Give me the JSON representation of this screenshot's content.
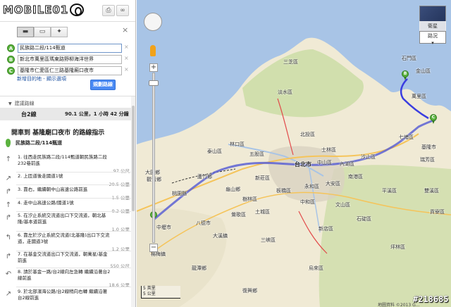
{
  "header": {
    "logo_text": "MOBILE01"
  },
  "toolbar": {
    "print_icon": "printer-icon",
    "link_icon": "link-icon"
  },
  "modes": [
    {
      "name": "drive",
      "glyph": "🚗",
      "active": true
    },
    {
      "name": "transit",
      "glyph": "🚌",
      "active": false
    },
    {
      "name": "walk",
      "glyph": "🚶",
      "active": false
    }
  ],
  "waypoints": [
    {
      "letter": "A",
      "value": "民族路二段/114甄道"
    },
    {
      "letter": "B",
      "value": "新北市萬里區瑪東路野柳海洋世界"
    },
    {
      "letter": "C",
      "value": "基隆市仁愛區仁三路基隆廟口夜市"
    }
  ],
  "route_links": "新增目的地 - 顯示選項",
  "route_button": "規劃路線",
  "suggested": {
    "heading": "建議路線",
    "route_name": "台2線",
    "distance_time": "90.1 公里，1 小時 42 分鐘"
  },
  "directions_title": "開車到 基隆廟口夜市 的路線指示",
  "start_label": "民族路二段/114甄道",
  "steps": [
    {
      "text": "1. 往西走民族路二段/114甄道朝民族路二段232巷前進",
      "dist": "97 公尺"
    },
    {
      "text": "2. 上匝道後走國道1號",
      "dist": "29.5 公里"
    },
    {
      "text": "3. 靠右，繼續朝中山高速公路前進",
      "dist": "1.5 公里"
    },
    {
      "text": "4. 走中山高速公路/國道1號",
      "dist": "9.2 公里"
    },
    {
      "text": "5. 在汐止系統交流道出口下交流道，朝北基隆/基本道前進",
      "dist": "1.0 公里"
    },
    {
      "text": "6. 靠左於汐止系統交流道(北基隆)出口下交流道，走國道3號",
      "dist": "1.2 公里"
    },
    {
      "text": "7. 在基金交流道出口下交流道，朝萬星/基金前進",
      "dist": "550 公尺"
    },
    {
      "text": "8. 請於基金一路/台2線向左急轉 繼續沿著台2線前進",
      "dist": "18.6 公里"
    },
    {
      "text": "9. 於北部濱海公路/台2線稍向右轉 繼續沿著台2線前進",
      "dist": ""
    }
  ],
  "map": {
    "satellite_label": "衛星",
    "traffic_label": "路況",
    "scale_miles": "5 英里",
    "scale_km": "5 公里",
    "attribution": "地圖資料 ©2013 G...",
    "watermark": "#218685",
    "places": [
      {
        "name": "石門區",
        "big": false
      },
      {
        "name": "金山區",
        "big": false
      },
      {
        "name": "萬里區",
        "big": false
      },
      {
        "name": "淡水區",
        "big": false
      },
      {
        "name": "三芝區",
        "big": false
      },
      {
        "name": "北投區",
        "big": false
      },
      {
        "name": "士林區",
        "big": false
      },
      {
        "name": "七堵區",
        "big": false
      },
      {
        "name": "汐止區",
        "big": false
      },
      {
        "name": "林口區",
        "big": false
      },
      {
        "name": "泰山區",
        "big": false
      },
      {
        "name": "五股區",
        "big": false
      },
      {
        "name": "台北市",
        "big": true
      },
      {
        "name": "中山區",
        "big": false
      },
      {
        "name": "內湖區",
        "big": false
      },
      {
        "name": "南港區",
        "big": false
      },
      {
        "name": "新莊區",
        "big": false
      },
      {
        "name": "板橋區",
        "big": false
      },
      {
        "name": "大安區",
        "big": false
      },
      {
        "name": "中和區",
        "big": false
      },
      {
        "name": "永和區",
        "big": false
      },
      {
        "name": "文山區",
        "big": false
      },
      {
        "name": "桃園縣",
        "big": false
      },
      {
        "name": "龜山鄉",
        "big": false
      },
      {
        "name": "中壢市",
        "big": false
      },
      {
        "name": "土城區",
        "big": false
      },
      {
        "name": "樹林區",
        "big": false
      },
      {
        "name": "鶯歌區",
        "big": false
      },
      {
        "name": "三峽區",
        "big": false
      },
      {
        "name": "新店區",
        "big": false
      },
      {
        "name": "石碇區",
        "big": false
      },
      {
        "name": "平溪區",
        "big": false
      },
      {
        "name": "雙溪區",
        "big": false
      },
      {
        "name": "瑞芳區",
        "big": false
      },
      {
        "name": "大溪鎮",
        "big": false
      },
      {
        "name": "八德市",
        "big": false
      },
      {
        "name": "楊梅鎮",
        "big": false
      },
      {
        "name": "觀音鄉",
        "big": false
      },
      {
        "name": "大園鄉",
        "big": false
      },
      {
        "name": "蘆竹鄉",
        "big": false
      },
      {
        "name": "復興鄉",
        "big": false
      },
      {
        "name": "坪林區",
        "big": false
      },
      {
        "name": "烏來區",
        "big": false
      },
      {
        "name": "龍潭鄉",
        "big": false
      },
      {
        "name": "貢寮區",
        "big": false
      },
      {
        "name": "基隆市",
        "big": false
      }
    ],
    "markers": [
      "A",
      "B",
      "C"
    ]
  }
}
